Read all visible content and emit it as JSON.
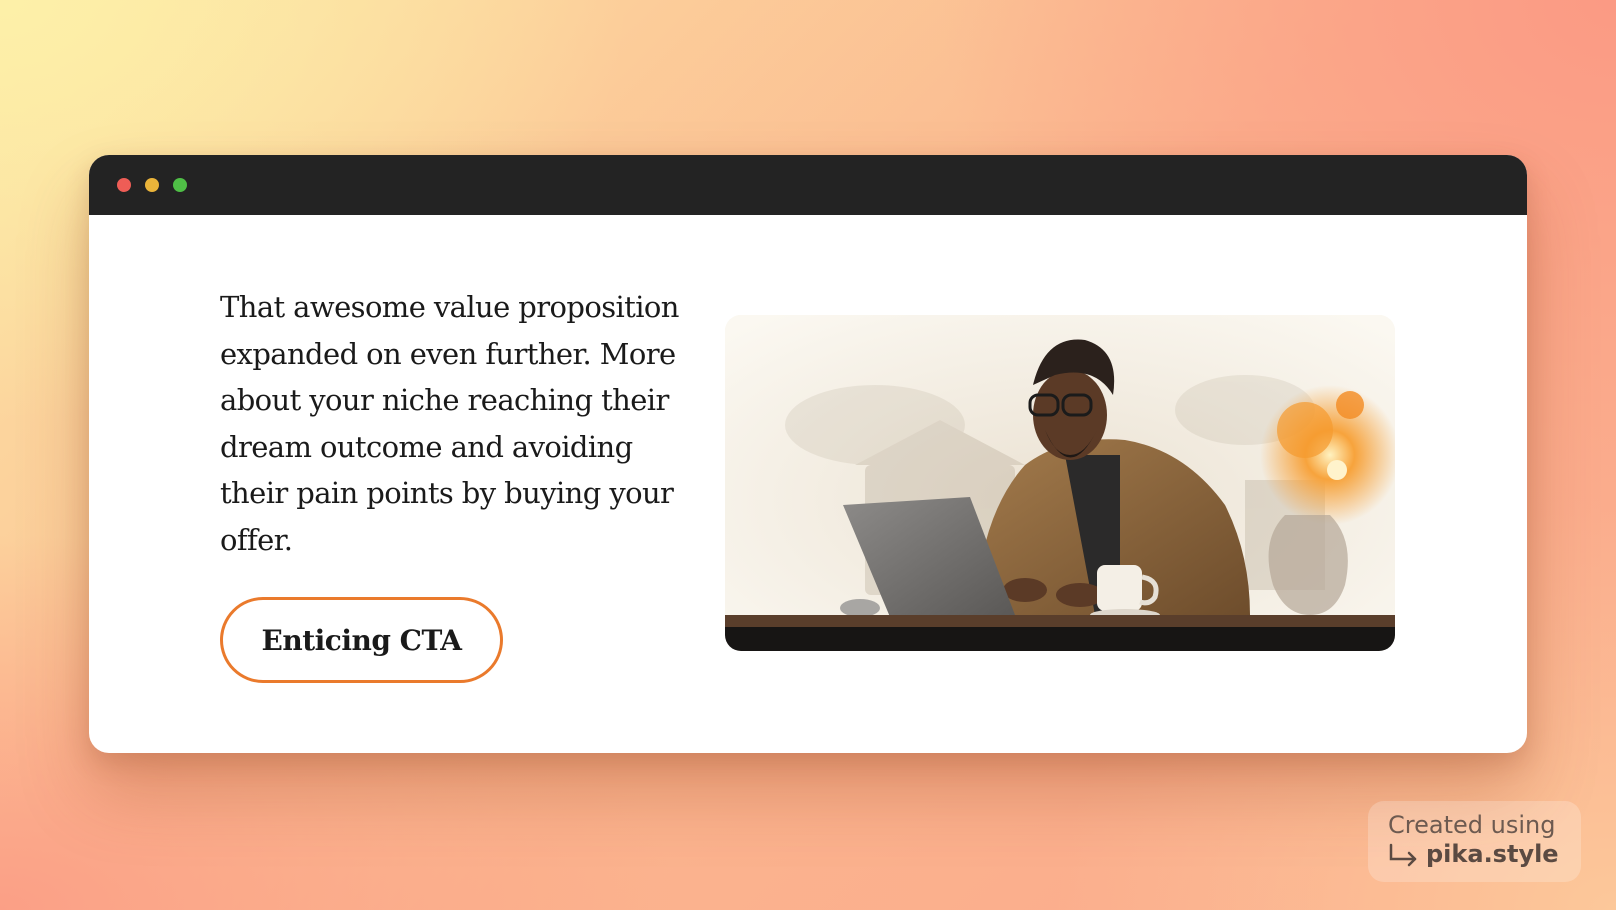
{
  "hero": {
    "description": "That awesome value proposition expanded on even further. More about your niche reaching their dream outcome and avoiding their pain points by buying your offer.",
    "cta_label": "Enticing CTA"
  },
  "window": {
    "controls": [
      "close",
      "minimize",
      "maximize"
    ]
  },
  "watermark": {
    "line1": "Created using",
    "line2": "pika.style"
  },
  "colors": {
    "accent": "#ea7a2c",
    "titlebar": "#232323",
    "close": "#ee5d56",
    "minimize": "#eab43a",
    "maximize": "#4fbf46"
  },
  "icons": {
    "watermark_arrow": "return-arrow-icon"
  }
}
